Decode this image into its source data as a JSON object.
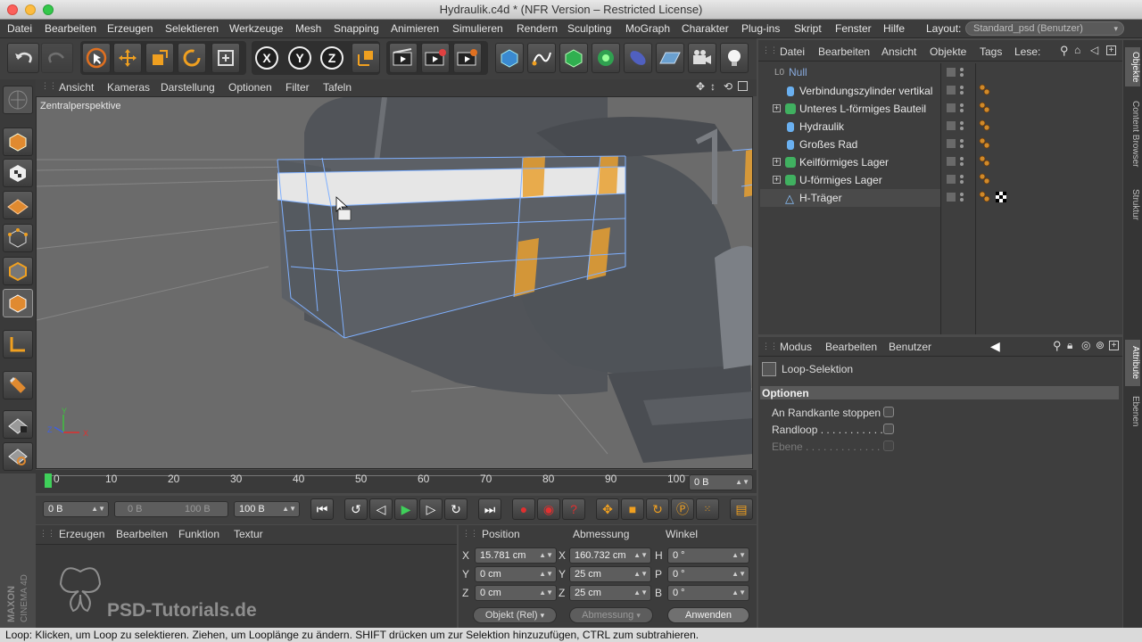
{
  "window": {
    "title": "Hydraulik.c4d * (NFR Version – Restricted License)"
  },
  "menubar": {
    "items": [
      "Datei",
      "Bearbeiten",
      "Erzeugen",
      "Selektieren",
      "Werkzeuge",
      "Mesh",
      "Snapping",
      "Animieren",
      "Simulieren",
      "Rendern",
      "Sculpting",
      "MoGraph",
      "Charakter",
      "Plug-ins",
      "Skript",
      "Fenster",
      "Hilfe"
    ],
    "layout_label": "Layout:",
    "layout_value": "Standard_psd (Benutzer)"
  },
  "toolbar": {
    "axis_x": "X",
    "axis_y": "Y",
    "axis_z": "Z",
    "icons": [
      "undo-icon",
      "redo-icon",
      "live-selection-icon",
      "move-icon",
      "scale-icon",
      "rotate-icon",
      "last-tool-icon",
      "x-axis-icon",
      "y-axis-icon",
      "z-axis-icon",
      "coordinate-system-icon",
      "render-view-icon",
      "render-picture-viewer-icon",
      "render-settings-icon",
      "cube-primitive-icon",
      "spline-pen-icon",
      "generator-icon",
      "mograph-cloner-icon",
      "deformer-icon",
      "floor-icon",
      "camera-icon",
      "light-icon"
    ]
  },
  "viewport": {
    "menu": [
      "Ansicht",
      "Kameras",
      "Darstellung",
      "Optionen",
      "Filter",
      "Tafeln"
    ],
    "label": "Zentralperspektive"
  },
  "timeline": {
    "ticks": [
      "0",
      "10",
      "20",
      "30",
      "40",
      "50",
      "60",
      "70",
      "80",
      "90",
      "100"
    ],
    "current_frame": "0 B"
  },
  "transport": {
    "start": "0 B",
    "preview_start": "0 B",
    "preview_end": "100 B",
    "end": "100 B"
  },
  "materials": {
    "menu": [
      "Erzeugen",
      "Bearbeiten",
      "Funktion",
      "Textur"
    ]
  },
  "coords": {
    "headers": [
      "Position",
      "Abmessung",
      "Winkel"
    ],
    "rows": [
      {
        "axis": "X",
        "pos": "15.781 cm",
        "size_axis": "X",
        "size": "160.732 cm",
        "rot_axis": "H",
        "rot": "0 °"
      },
      {
        "axis": "Y",
        "pos": "0 cm",
        "size_axis": "Y",
        "size": "25 cm",
        "rot_axis": "P",
        "rot": "0 °"
      },
      {
        "axis": "Z",
        "pos": "0 cm",
        "size_axis": "Z",
        "size": "25 cm",
        "rot_axis": "B",
        "rot": "0 °"
      }
    ],
    "mode_select": "Objekt (Rel)",
    "size_select": "Abmessung",
    "apply_button": "Anwenden"
  },
  "object_manager": {
    "menu": [
      "Datei",
      "Bearbeiten",
      "Ansicht",
      "Objekte",
      "Tags",
      "Lese:"
    ],
    "objects": [
      {
        "name": "Null",
        "expanded": false
      },
      {
        "name": "Verbindungszylinder vertikal",
        "expanded": false
      },
      {
        "name": "Unteres L-förmiges Bauteil",
        "expanded": true
      },
      {
        "name": "Hydraulik",
        "expanded": false
      },
      {
        "name": "Großes Rad",
        "expanded": false
      },
      {
        "name": "Keilförmiges Lager",
        "expanded": true
      },
      {
        "name": "U-förmiges Lager",
        "expanded": true
      },
      {
        "name": "H-Träger",
        "expanded": false
      }
    ]
  },
  "attribute_manager": {
    "menu": [
      "Modus",
      "Bearbeiten",
      "Benutzer"
    ],
    "tool_title": "Loop-Selektion",
    "section": "Optionen",
    "options": [
      {
        "label": "An Randkante stoppen",
        "checked": false,
        "enabled": true
      },
      {
        "label": "Randloop . . . . . . . . . . .",
        "checked": false,
        "enabled": true
      },
      {
        "label": "Ebene . . . . . . . . . . . . .",
        "checked": false,
        "enabled": false
      }
    ]
  },
  "right_tabs": [
    "Objekte",
    "Content Browser",
    "Struktur",
    "Attribute",
    "Ebenen"
  ],
  "branding": {
    "maxon": "MAXON",
    "cinema": "CINEMA 4D",
    "watermark": "PSD-Tutorials.de"
  },
  "status": "Loop: Klicken, um Loop zu selektieren. Ziehen, um Looplänge zu ändern. SHIFT drücken um zur Selektion hinzuzufügen, CTRL zum subtrahieren."
}
